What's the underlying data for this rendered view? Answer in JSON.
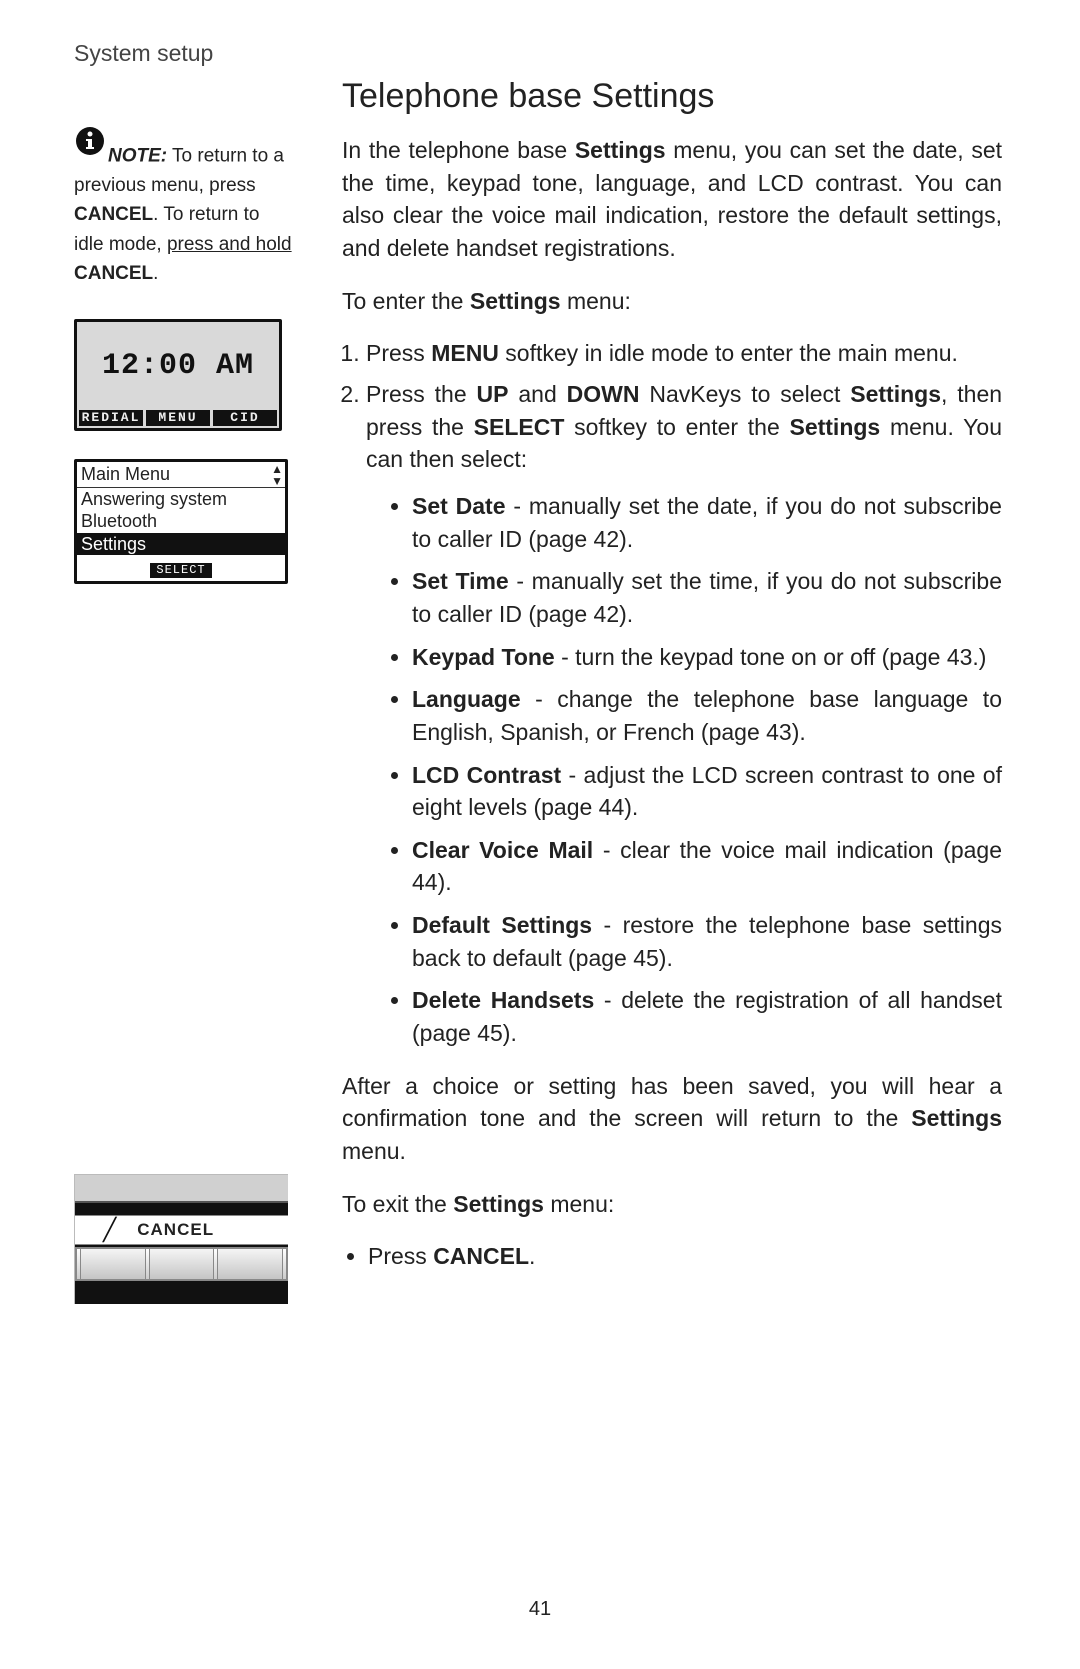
{
  "header": "System setup",
  "note": {
    "label": "NOTE:",
    "text1": " To return to a previous menu, press ",
    "cancel1": "CANCEL",
    "text2": ". To return to idle mode, ",
    "underline": "press and hold",
    "cancel2": "CANCEL",
    "period": "."
  },
  "lcd1": {
    "time": "12:00 AM",
    "softkeys": [
      "REDIAL",
      "MENU",
      "CID"
    ]
  },
  "lcd2": {
    "title": "Main Menu",
    "items": [
      "Answering system",
      "Bluetooth",
      "Settings"
    ],
    "selected_index": 2,
    "select_label": "SELECT"
  },
  "cancel_fig": {
    "label": "CANCEL"
  },
  "title": "Telephone base Settings",
  "intro": {
    "pre": "In the telephone base ",
    "b1": "Settings",
    "post": " menu, you can set the date, set the time, keypad tone, language, and LCD contrast. You can also clear the voice mail indication, restore the default settings, and delete handset registrations."
  },
  "to_enter": {
    "pre": "To enter the ",
    "b": "Settings",
    "post": " menu:"
  },
  "steps": [
    {
      "pre": "Press ",
      "b1": "MENU",
      "post": " softkey in idle mode to enter the main menu."
    },
    {
      "pre": "Press the ",
      "b1": "UP",
      "mid1": " and ",
      "b2": "DOWN",
      "mid2": " NavKeys to select ",
      "b3": "Settings",
      "mid3": ", then press the ",
      "b4": "SELECT",
      "mid4": " softkey to enter the ",
      "b5": "Settings",
      "post": " menu. You can then select:"
    }
  ],
  "options": [
    {
      "b": "Set Date",
      "t": " - manually set the date, if you do not subscribe to caller ID (page 42)."
    },
    {
      "b": "Set Time",
      "t": " - manually set the time, if you do not subscribe to caller ID (page 42)."
    },
    {
      "b": "Keypad Tone",
      "t": " - turn the keypad tone on or off (page 43.)"
    },
    {
      "b": "Language",
      "t": " - change the telephone base language to English, Spanish, or French (page 43)."
    },
    {
      "b": "LCD Contrast",
      "t": " - adjust the LCD screen contrast to one of eight levels (page 44)."
    },
    {
      "b": "Clear Voice Mail",
      "t": " - clear the voice mail indication (page 44)."
    },
    {
      "b": "Default Settings",
      "t": " - restore the telephone base settings back to default (page 45)."
    },
    {
      "b": "Delete Handsets",
      "t": " - delete the registration of all handset (page 45)."
    }
  ],
  "after": {
    "pre": "After a choice or setting has been saved, you will hear a confirmation tone and the screen will return to the ",
    "b": "Settings",
    "post": " menu."
  },
  "to_exit": {
    "pre": "To exit the ",
    "b": "Settings",
    "post": " menu:"
  },
  "exit_step": {
    "pre": "Press ",
    "b": "CANCEL",
    "post": "."
  },
  "page_number": "41"
}
